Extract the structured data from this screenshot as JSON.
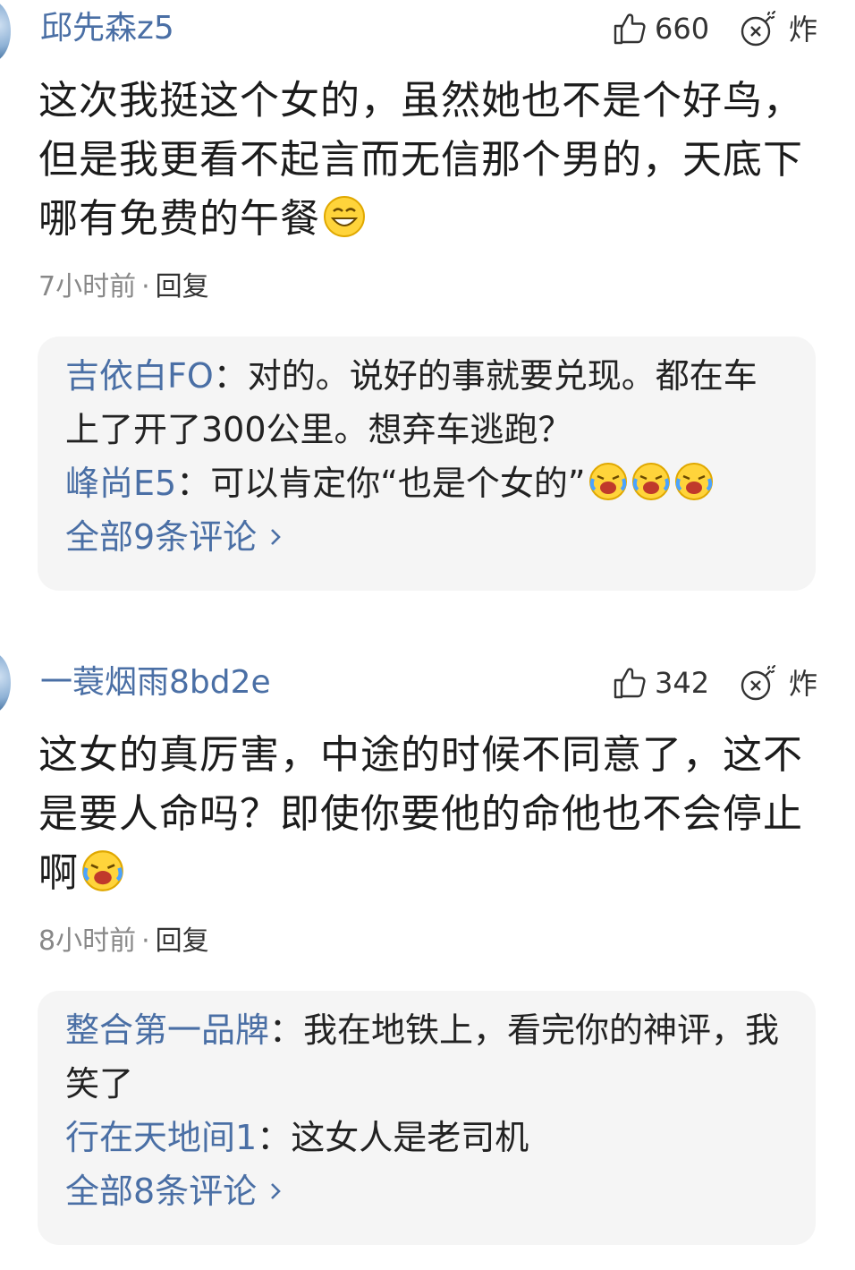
{
  "comments": [
    {
      "username": "邱先森z5",
      "likes": "660",
      "zha_label": "炸",
      "content": "这次我挺这个女的，虽然她也不是个好鸟，但是我更看不起言而无信那个男的，天底下哪有免费的午餐",
      "content_emoji": "grinning-face-emoji",
      "time": "7小时前",
      "dot": "·",
      "reply_label": "回复",
      "replies": [
        {
          "name": "吉依白FO",
          "sep": "：",
          "text": "对的。说好的事就要兑现。都在车上了开了300公里。想弃车逃跑？",
          "emojis": []
        },
        {
          "name": "峰尚E5",
          "sep": "：",
          "text": "可以肯定你“也是个女的”",
          "emojis": [
            "crying-laughing-emoji",
            "crying-laughing-emoji",
            "crying-laughing-emoji"
          ]
        }
      ],
      "all_link": "全部9条评论"
    },
    {
      "username": "一蓑烟雨8bd2e",
      "likes": "342",
      "zha_label": "炸",
      "content": "这女的真厉害，中途的时候不同意了，这不是要人命吗？即使你要他的命他也不会停止啊",
      "content_emoji": "crying-laughing-emoji",
      "time": "8小时前",
      "dot": "·",
      "reply_label": "回复",
      "replies": [
        {
          "name": "整合第一品牌",
          "sep": "：",
          "text": "我在地铁上，看完你的神评，我笑了",
          "emojis": []
        },
        {
          "name": "行在天地间1",
          "sep": "：",
          "text": "这女人是老司机",
          "emojis": []
        }
      ],
      "all_link": "全部8条评论"
    }
  ],
  "colors": {
    "link_blue": "#4a6fa5",
    "reply_bg": "#f5f5f5",
    "meta_gray": "#888888"
  }
}
